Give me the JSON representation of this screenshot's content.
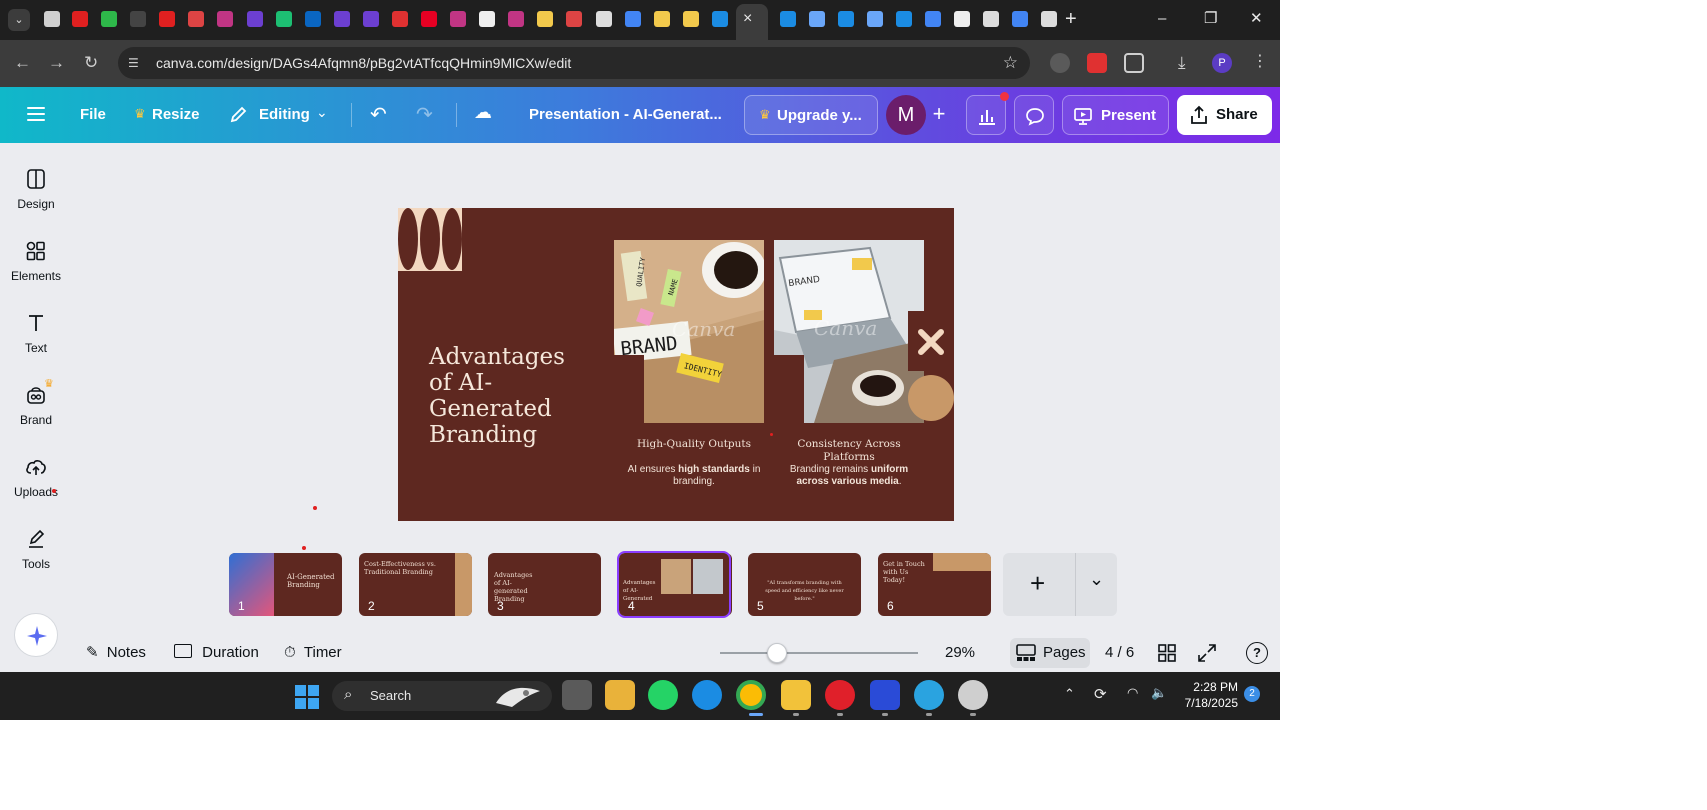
{
  "browser": {
    "active_tab_close": "×",
    "new_tab": "+",
    "url": "canva.com/design/DAGs4Afqmn8/pBg2vtATfcqQHmin9MlCXw/edit",
    "profile_initial": "P",
    "window_controls": {
      "minimize": "–",
      "restore": "❐",
      "close": "✕"
    }
  },
  "canva_header": {
    "menu_icon": "hamburger-menu-icon",
    "file_label": "File",
    "resize_label": "Resize",
    "editing_label": "Editing",
    "title": "Presentation - AI-Generat...",
    "upgrade_label": "Upgrade y...",
    "user_initial": "M",
    "add_collaborator": "+",
    "present_label": "Present",
    "share_label": "Share",
    "colors": {
      "accent": "#7d2ae8",
      "teal": "#10b8c9",
      "notification": "#f2323f"
    }
  },
  "sidebar": {
    "items": [
      {
        "label": "Design",
        "icon": "design-icon"
      },
      {
        "label": "Elements",
        "icon": "elements-icon"
      },
      {
        "label": "Text",
        "icon": "text-icon"
      },
      {
        "label": "Brand",
        "icon": "brand-icon"
      },
      {
        "label": "Uploads",
        "icon": "uploads-icon"
      },
      {
        "label": "Tools",
        "icon": "tools-icon"
      }
    ]
  },
  "slide": {
    "title": "Advantages of AI-Generated Branding",
    "columns": [
      {
        "caption": "High-Quality Outputs",
        "body_pre": "AI ensures ",
        "body_bold": "high standards",
        "body_post": " in branding."
      },
      {
        "caption": "Consistency Across Platforms",
        "body_pre": "Branding remains ",
        "body_bold": "uniform across various media",
        "body_post": "."
      }
    ],
    "photo_notes": [
      "QUALITY",
      "NAME",
      "BRAND",
      "IDENTITY"
    ],
    "screen_text": "BRAND",
    "watermark": "Canva",
    "colors": {
      "background": "#5e2820",
      "tan": "#c89868",
      "cream": "#f3d8c0"
    }
  },
  "pages": {
    "thumbnails": [
      {
        "num": "1",
        "title": "AI-Generated Branding"
      },
      {
        "num": "2",
        "title": "Cost-Effectiveness vs. Traditional Branding"
      },
      {
        "num": "3",
        "title": "Advantages of AI-generated Branding"
      },
      {
        "num": "4",
        "title": "Advantages of AI-Generated"
      },
      {
        "num": "5",
        "title": "\"AI transforms branding with speed and efficiency like never before.\""
      },
      {
        "num": "6",
        "title": "Get in Touch with Us Today!"
      }
    ],
    "add_page": "+",
    "expand": "⌄"
  },
  "bottom_bar": {
    "notes_label": "Notes",
    "duration_label": "Duration",
    "timer_label": "Timer",
    "zoom_label": "29%",
    "zoom_fraction": 0.29,
    "pages_label": "Pages",
    "page_counter": "4 / 6",
    "help": "?"
  },
  "taskbar": {
    "search_label": "Search",
    "time": "2:28 PM",
    "date": "7/18/2025",
    "notification_count": "2"
  }
}
